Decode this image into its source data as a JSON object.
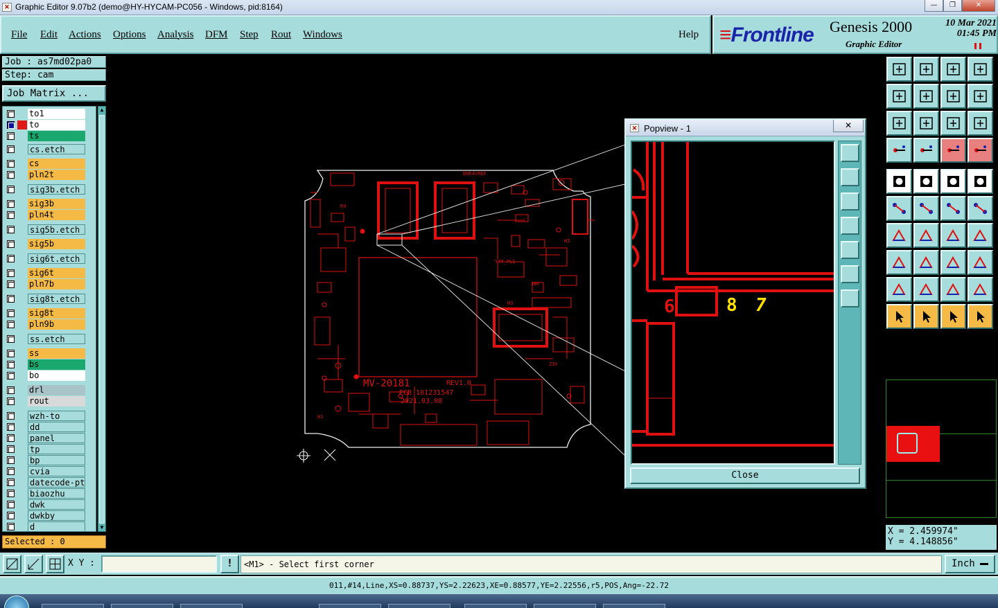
{
  "window": {
    "title": "Graphic Editor 9.07b2 (demo@HY-HYCAM-PC056 - Windows, pid:8164)",
    "min_label": "—",
    "max_label": "❐",
    "close_label": "✕"
  },
  "menu": {
    "items": [
      "File",
      "Edit",
      "Actions",
      "Options",
      "Analysis",
      "DFM",
      "Step",
      "Rout",
      "Windows"
    ],
    "help": "Help"
  },
  "brand": {
    "logo": "Frontline",
    "product": "Genesis 2000",
    "subtitle": "Graphic Editor",
    "date": "10 Mar 2021",
    "time": "01:45 PM"
  },
  "job": {
    "job_label": "Job : as7md02pa0",
    "step_label": "Step: cam",
    "matrix_button": "Job Matrix ..."
  },
  "layers": [
    {
      "name": "to1",
      "color": "#ffffff",
      "swatch": "",
      "active": false
    },
    {
      "name": "to",
      "color": "#ffffff",
      "swatch": "#e01818",
      "active": true
    },
    {
      "name": "ts",
      "color": "#1ba86e",
      "swatch": "",
      "active": false
    },
    {
      "name": "cs.etch",
      "color": "#a6dcdc",
      "swatch": "",
      "active": false
    },
    {
      "name": "cs",
      "color": "#f5b945",
      "swatch": "",
      "active": false
    },
    {
      "name": "pln2t",
      "color": "#f5b945",
      "swatch": "",
      "active": false
    },
    {
      "name": "sig3b.etch",
      "color": "#a6dcdc",
      "swatch": "",
      "active": false
    },
    {
      "name": "sig3b",
      "color": "#f5b945",
      "swatch": "",
      "active": false
    },
    {
      "name": "pln4t",
      "color": "#f5b945",
      "swatch": "",
      "active": false
    },
    {
      "name": "sig5b.etch",
      "color": "#a6dcdc",
      "swatch": "",
      "active": false
    },
    {
      "name": "sig5b",
      "color": "#f5b945",
      "swatch": "",
      "active": false
    },
    {
      "name": "sig6t.etch",
      "color": "#a6dcdc",
      "swatch": "",
      "active": false
    },
    {
      "name": "sig6t",
      "color": "#f5b945",
      "swatch": "",
      "active": false
    },
    {
      "name": "pln7b",
      "color": "#f5b945",
      "swatch": "",
      "active": false
    },
    {
      "name": "sig8t.etch",
      "color": "#a6dcdc",
      "swatch": "",
      "active": false
    },
    {
      "name": "sig8t",
      "color": "#f5b945",
      "swatch": "",
      "active": false
    },
    {
      "name": "pln9b",
      "color": "#f5b945",
      "swatch": "",
      "active": false
    },
    {
      "name": "ss.etch",
      "color": "#a6dcdc",
      "swatch": "",
      "active": false
    },
    {
      "name": "ss",
      "color": "#f5b945",
      "swatch": "",
      "active": false
    },
    {
      "name": "bs",
      "color": "#1ba86e",
      "swatch": "",
      "active": false
    },
    {
      "name": "bo",
      "color": "#ffffff",
      "swatch": "",
      "active": false
    },
    {
      "name": "drl",
      "color": "#a8c4c8",
      "swatch": "",
      "active": false
    },
    {
      "name": "rout",
      "color": "#d8dada",
      "swatch": "",
      "active": false
    },
    {
      "name": "wzh-to",
      "color": "#a6dcdc",
      "swatch": "",
      "active": false
    },
    {
      "name": "dd",
      "color": "#a6dcdc",
      "swatch": "",
      "active": false
    },
    {
      "name": "panel",
      "color": "#a6dcdc",
      "swatch": "",
      "active": false
    },
    {
      "name": "tp",
      "color": "#a6dcdc",
      "swatch": "",
      "active": false
    },
    {
      "name": "bp",
      "color": "#a6dcdc",
      "swatch": "",
      "active": false
    },
    {
      "name": "cvia",
      "color": "#a6dcdc",
      "swatch": "",
      "active": false
    },
    {
      "name": "datecode-pto",
      "color": "#a6dcdc",
      "swatch": "",
      "active": false
    },
    {
      "name": "biaozhu",
      "color": "#a6dcdc",
      "swatch": "",
      "active": false
    },
    {
      "name": "dwk",
      "color": "#a6dcdc",
      "swatch": "",
      "active": false
    },
    {
      "name": "dwkby",
      "color": "#a6dcdc",
      "swatch": "",
      "active": false
    },
    {
      "name": "d",
      "color": "#a6dcdc",
      "swatch": "",
      "active": false
    }
  ],
  "selected": "Selected : 0",
  "board": {
    "silk": [
      "MV-20181",
      "REV1.0",
      "PCB 101231547",
      "2021.03.08"
    ],
    "labels": [
      "DDR4VREF",
      "YTT_PL1",
      "H2",
      "H1",
      "H3",
      "Z3V",
      "R4",
      "J8V"
    ]
  },
  "popview": {
    "title": "Popview - 1",
    "close_x": "✕",
    "close_button": "Close",
    "glyphs": [
      "6",
      "8",
      "7"
    ]
  },
  "coords": {
    "x": "X = 2.459974\"",
    "y": "Y = 4.148856\""
  },
  "bottom": {
    "xy_label": "X Y :",
    "xy_value": "",
    "warn": "!",
    "prompt": "<M1> - Select first corner",
    "unit": "Inch"
  },
  "status": "011,#14,Line,XS=0.88737,YS=2.22623,XE=0.88577,YE=2.22556,r5,POS,Ang=-22.72",
  "colors": {
    "panel": "#a6dcdc",
    "trace": "#e01010",
    "accent": "#f5b945",
    "highlight": "#ffe000"
  }
}
